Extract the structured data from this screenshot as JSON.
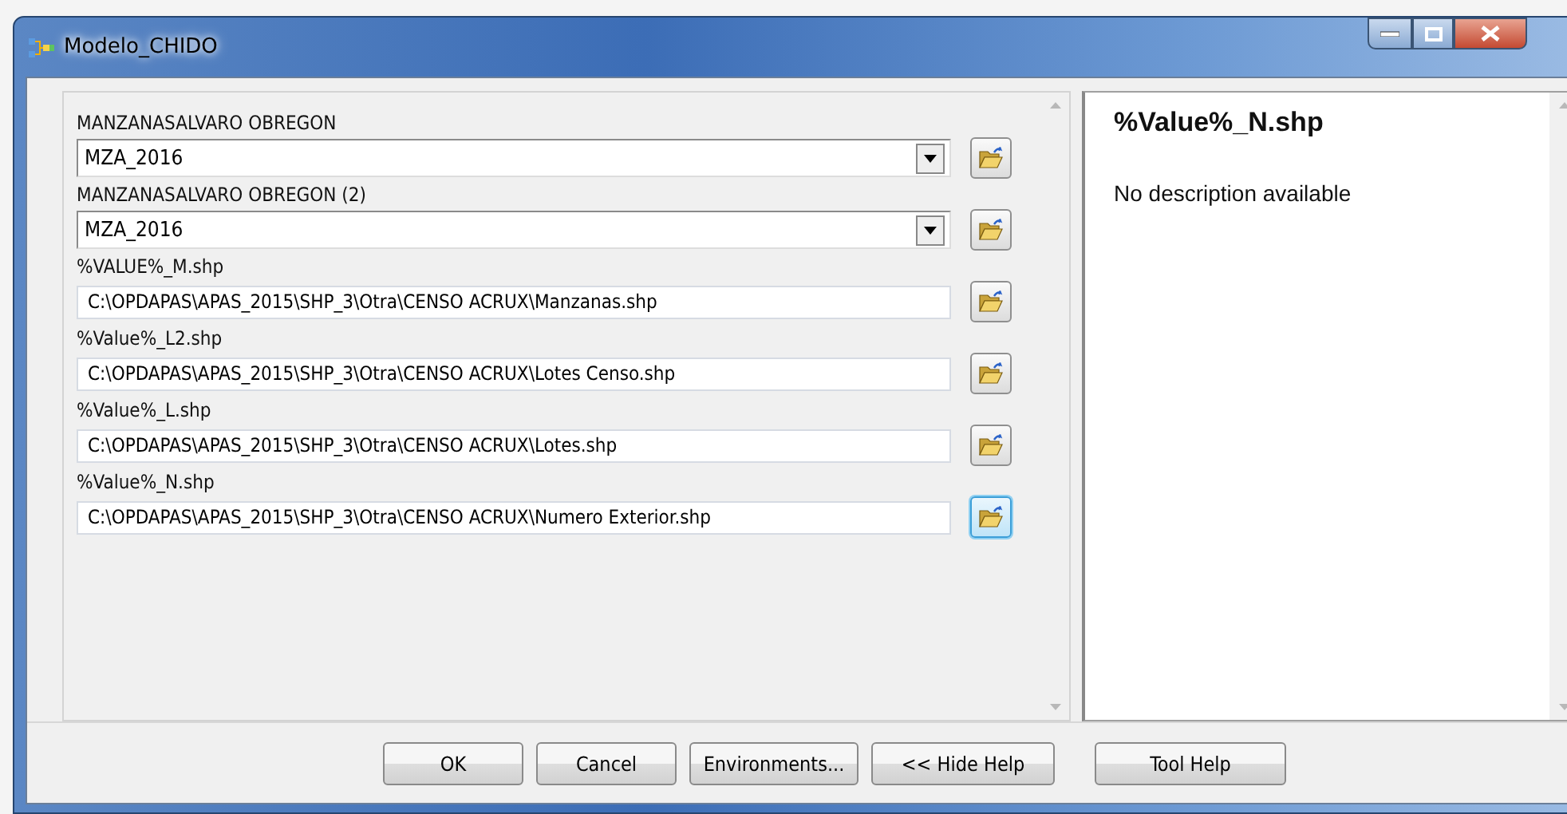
{
  "window": {
    "title": "Modelo_CHIDO"
  },
  "parameters": [
    {
      "label": "MANZANASALVARO OBREGON",
      "kind": "dropdown",
      "value": "MZA_2016",
      "focused": false
    },
    {
      "label": "MANZANASALVARO OBREGON (2)",
      "kind": "dropdown",
      "value": "MZA_2016",
      "focused": false
    },
    {
      "label": "%VALUE%_M.shp",
      "kind": "path",
      "value": "C:\\OPDAPAS\\APAS_2015\\SHP_3\\Otra\\CENSO ACRUX\\Manzanas.shp",
      "focused": false
    },
    {
      "label": "%Value%_L2.shp",
      "kind": "path",
      "value": "C:\\OPDAPAS\\APAS_2015\\SHP_3\\Otra\\CENSO ACRUX\\Lotes Censo.shp",
      "focused": false
    },
    {
      "label": "%Value%_L.shp",
      "kind": "path",
      "value": "C:\\OPDAPAS\\APAS_2015\\SHP_3\\Otra\\CENSO ACRUX\\Lotes.shp",
      "focused": false
    },
    {
      "label": "%Value%_N.shp",
      "kind": "path",
      "value": "C:\\OPDAPAS\\APAS_2015\\SHP_3\\Otra\\CENSO ACRUX\\Numero Exterior.shp",
      "focused": true
    }
  ],
  "help": {
    "title": "%Value%_N.shp",
    "description": "No description available"
  },
  "buttons": [
    "OK",
    "Cancel",
    "Environments...",
    "<< Hide Help",
    "Tool Help"
  ]
}
